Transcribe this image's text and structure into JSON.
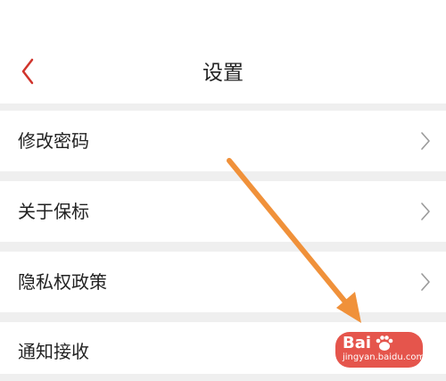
{
  "header": {
    "title": "设置",
    "back_icon": "chevron-left-icon",
    "accent_color": "#d0342c"
  },
  "settings": {
    "items": [
      {
        "label": "修改密码",
        "icon": "chevron-right-icon"
      },
      {
        "label": "关于保标",
        "icon": "chevron-right-icon"
      },
      {
        "label": "隐私权政策",
        "icon": "chevron-right-icon"
      },
      {
        "label": "通知接收"
      }
    ]
  },
  "annotation": {
    "arrow_color": "#f0913a"
  },
  "watermark": {
    "logo": "Bai",
    "url": "jingyan.baidu.com"
  }
}
